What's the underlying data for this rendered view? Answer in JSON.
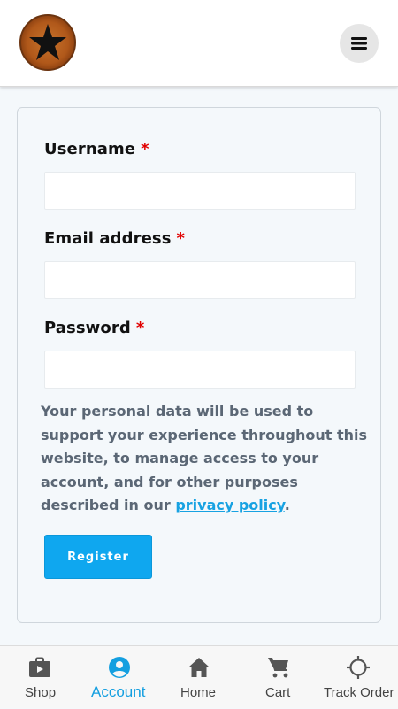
{
  "header": {
    "logo_icon": "star-badge-logo",
    "menu_icon": "hamburger-menu-icon"
  },
  "form": {
    "username": {
      "label": "Username",
      "required_mark": "*",
      "value": ""
    },
    "email": {
      "label": "Email address",
      "required_mark": "*",
      "value": ""
    },
    "password": {
      "label": "Password",
      "required_mark": "*",
      "value": ""
    },
    "privacy_text_before": "Your personal data will be used to support your experience throughout this website, to manage access to your account, and for other purposes described in our ",
    "privacy_link": "privacy policy",
    "privacy_text_after": ".",
    "register_label": "Register"
  },
  "bottom_nav": {
    "items": [
      {
        "label": "Shop",
        "icon": "shop-bag-icon",
        "active": false
      },
      {
        "label": "Account",
        "icon": "account-icon",
        "active": true
      },
      {
        "label": "Home",
        "icon": "home-icon",
        "active": false
      },
      {
        "label": "Cart",
        "icon": "cart-icon",
        "active": false
      },
      {
        "label": "Track Order",
        "icon": "track-order-icon",
        "active": false
      }
    ]
  },
  "colors": {
    "accent": "#0fa7ef",
    "link": "#17a2e2",
    "required": "#e10000",
    "active_nav": "#149fe0"
  }
}
